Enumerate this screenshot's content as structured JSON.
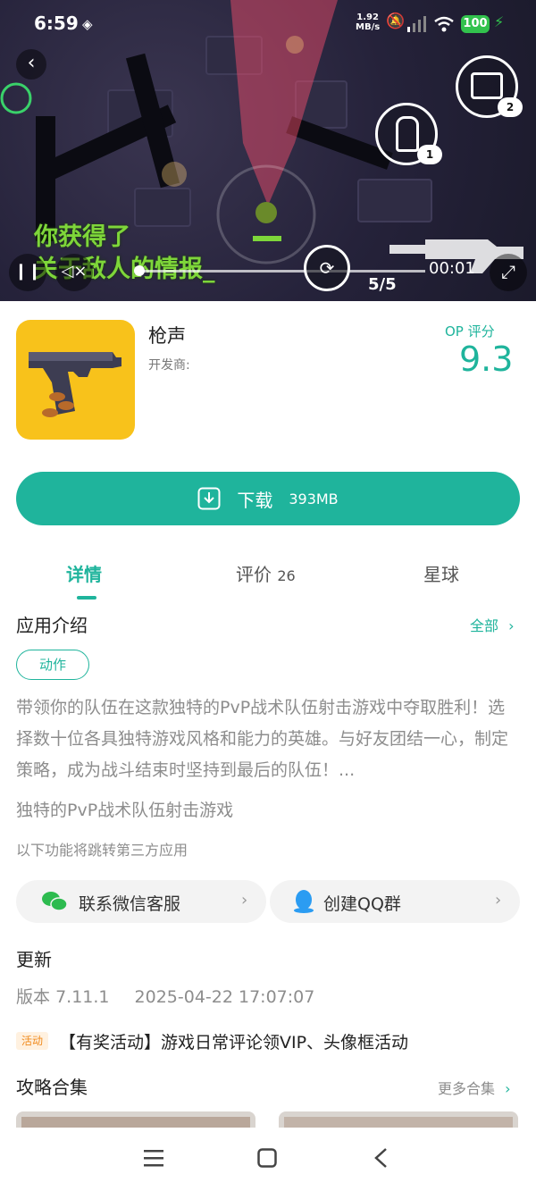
{
  "status_bar": {
    "time": "6:59",
    "net_speed_value": "1.92",
    "net_speed_unit": "MB/s",
    "battery": "100"
  },
  "video": {
    "overlay_text_line1": "你获得了",
    "overlay_text_line2": "关于敌人的情报_",
    "timestamp": "00:01",
    "ammo_counter": "5/5",
    "ability1_count": "1",
    "ability2_count": "2"
  },
  "app": {
    "name": "枪声",
    "developer_label": "开发商:",
    "score_label": "OP 评分",
    "score": "9.3"
  },
  "download": {
    "label": "下载",
    "size": "393MB"
  },
  "tabs": [
    {
      "label": "详情",
      "count": ""
    },
    {
      "label": "评价",
      "count": "26"
    },
    {
      "label": "星球",
      "count": ""
    }
  ],
  "intro": {
    "title": "应用介绍",
    "all_link": "全部",
    "tag": "动作",
    "description": "带领你的队伍在这款独特的PvP战术队伍射击游戏中夺取胜利！选择数十位各具独特游戏风格和能力的英雄。与好友团结一心，制定策略，成为战斗结束时坚持到最后的队伍！...",
    "subtitle": "独特的PvP战术队伍射击游戏",
    "third_party_note": "以下功能将跳转第三方应用"
  },
  "contact": {
    "wechat_label": "联系微信客服",
    "qq_label": "创建QQ群"
  },
  "update": {
    "title": "更新",
    "version_label": "版本",
    "version": "7.11.1",
    "date": "2025-04-22 17:07:07"
  },
  "event": {
    "badge": "活动",
    "text": "【有奖活动】游戏日常评论领VIP、头像框活动"
  },
  "guides": {
    "title": "攻略合集",
    "more_link": "更多合集"
  },
  "colors": {
    "accent": "#1fb49c",
    "icon_bg": "#f8c21b",
    "event_orange": "#f08a1c",
    "overlay_green": "#7ed63a"
  }
}
